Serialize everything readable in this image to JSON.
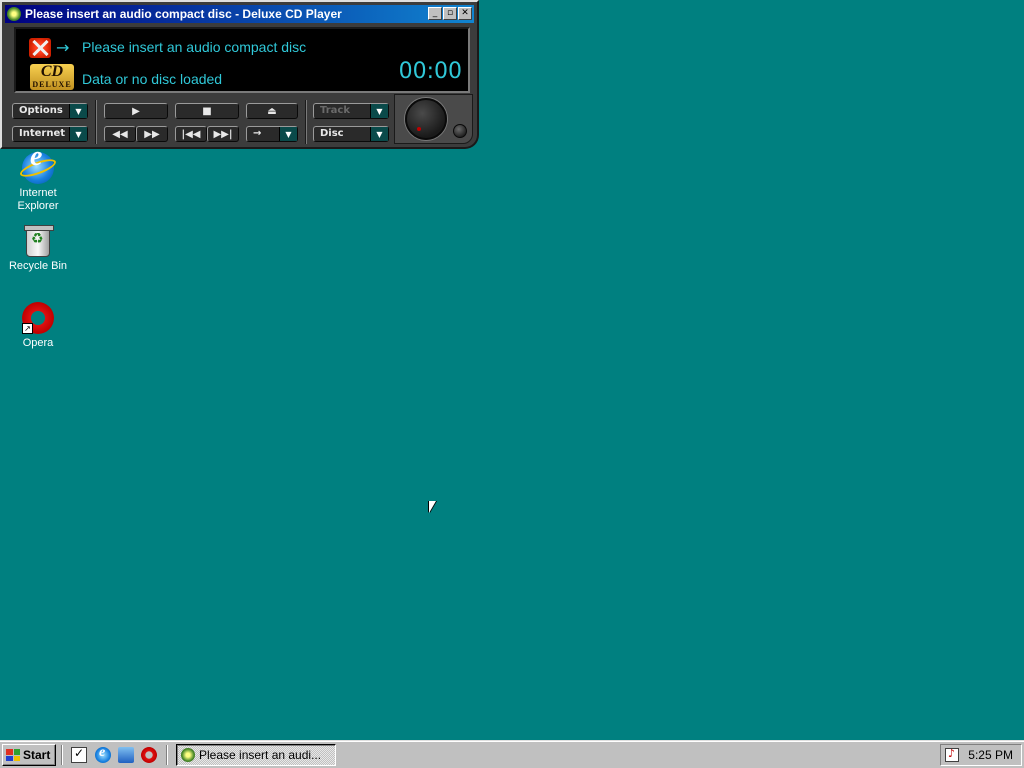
{
  "window": {
    "title": "Please insert an audio compact disc - Deluxe CD Player",
    "lcd": {
      "line1": "Please insert an audio compact disc",
      "line2": "Data or no disc loaded",
      "time": "00:00",
      "logo": "CD",
      "logo_sub": "DELUXE"
    },
    "buttons": {
      "options": "Options",
      "internet": "Internet",
      "play": "▶",
      "stop": "■",
      "eject": "⏏",
      "rewind": "◀◀",
      "fastforward": "▶▶",
      "prev_track": "|◀◀",
      "next_track": "▶▶|",
      "mode": "→",
      "track": "Track",
      "disc": "Disc"
    }
  },
  "desktop": {
    "icons": [
      {
        "label": "Internet Explorer"
      },
      {
        "label": "Recycle Bin"
      },
      {
        "label": "Opera"
      }
    ]
  },
  "taskbar": {
    "start_label": "Start",
    "task_label": "Please insert an audi...",
    "clock": "5:25 PM"
  },
  "colors": {
    "desktop": "#008080",
    "lcd_text": "#30c8d8",
    "titlebar_start": "#000080",
    "titlebar_end": "#1084d0"
  }
}
